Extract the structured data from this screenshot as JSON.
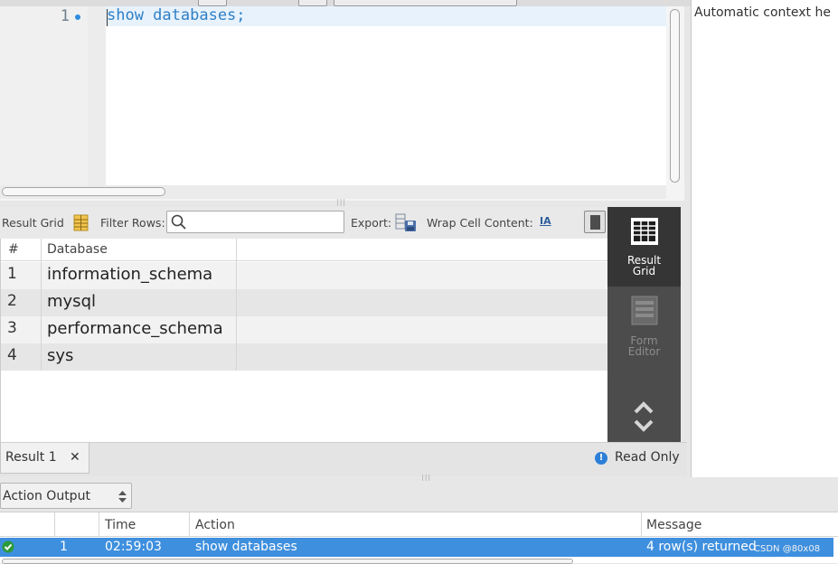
{
  "editor": {
    "line_number": "1",
    "code": "show databases;"
  },
  "context_help": {
    "text": "Automatic context he"
  },
  "result_toolbar": {
    "result_grid_label": "Result Grid",
    "filter_rows_label": "Filter Rows:",
    "filter_value": "",
    "export_label": "Export:",
    "wrap_label": "Wrap Cell Content:",
    "wrap_icon_text": "IA"
  },
  "grid": {
    "columns": [
      "#",
      "Database"
    ],
    "rows": [
      {
        "num": "1",
        "database": "information_schema"
      },
      {
        "num": "2",
        "database": "mysql"
      },
      {
        "num": "3",
        "database": "performance_schema"
      },
      {
        "num": "4",
        "database": "sys"
      }
    ]
  },
  "side_panel": {
    "result_grid_line1": "Result",
    "result_grid_line2": "Grid",
    "form_editor_line1": "Form",
    "form_editor_line2": "Editor"
  },
  "result_tabs": {
    "tab_label": "Result 1",
    "close_glyph": "✕",
    "status": "Read Only"
  },
  "output": {
    "selector_label": "Action Output",
    "columns": {
      "time": "Time",
      "action": "Action",
      "message": "Message"
    },
    "rows": [
      {
        "num": "1",
        "time": "02:59:03",
        "action": "show databases",
        "message": "4 row(s) returned"
      }
    ]
  },
  "watermark": "CSDN @80x08",
  "colors": {
    "keyword": "#2d7fc6",
    "selection": "#3e8fde",
    "side_panel": "#4c4c4c",
    "success": "#2c9a3a"
  }
}
